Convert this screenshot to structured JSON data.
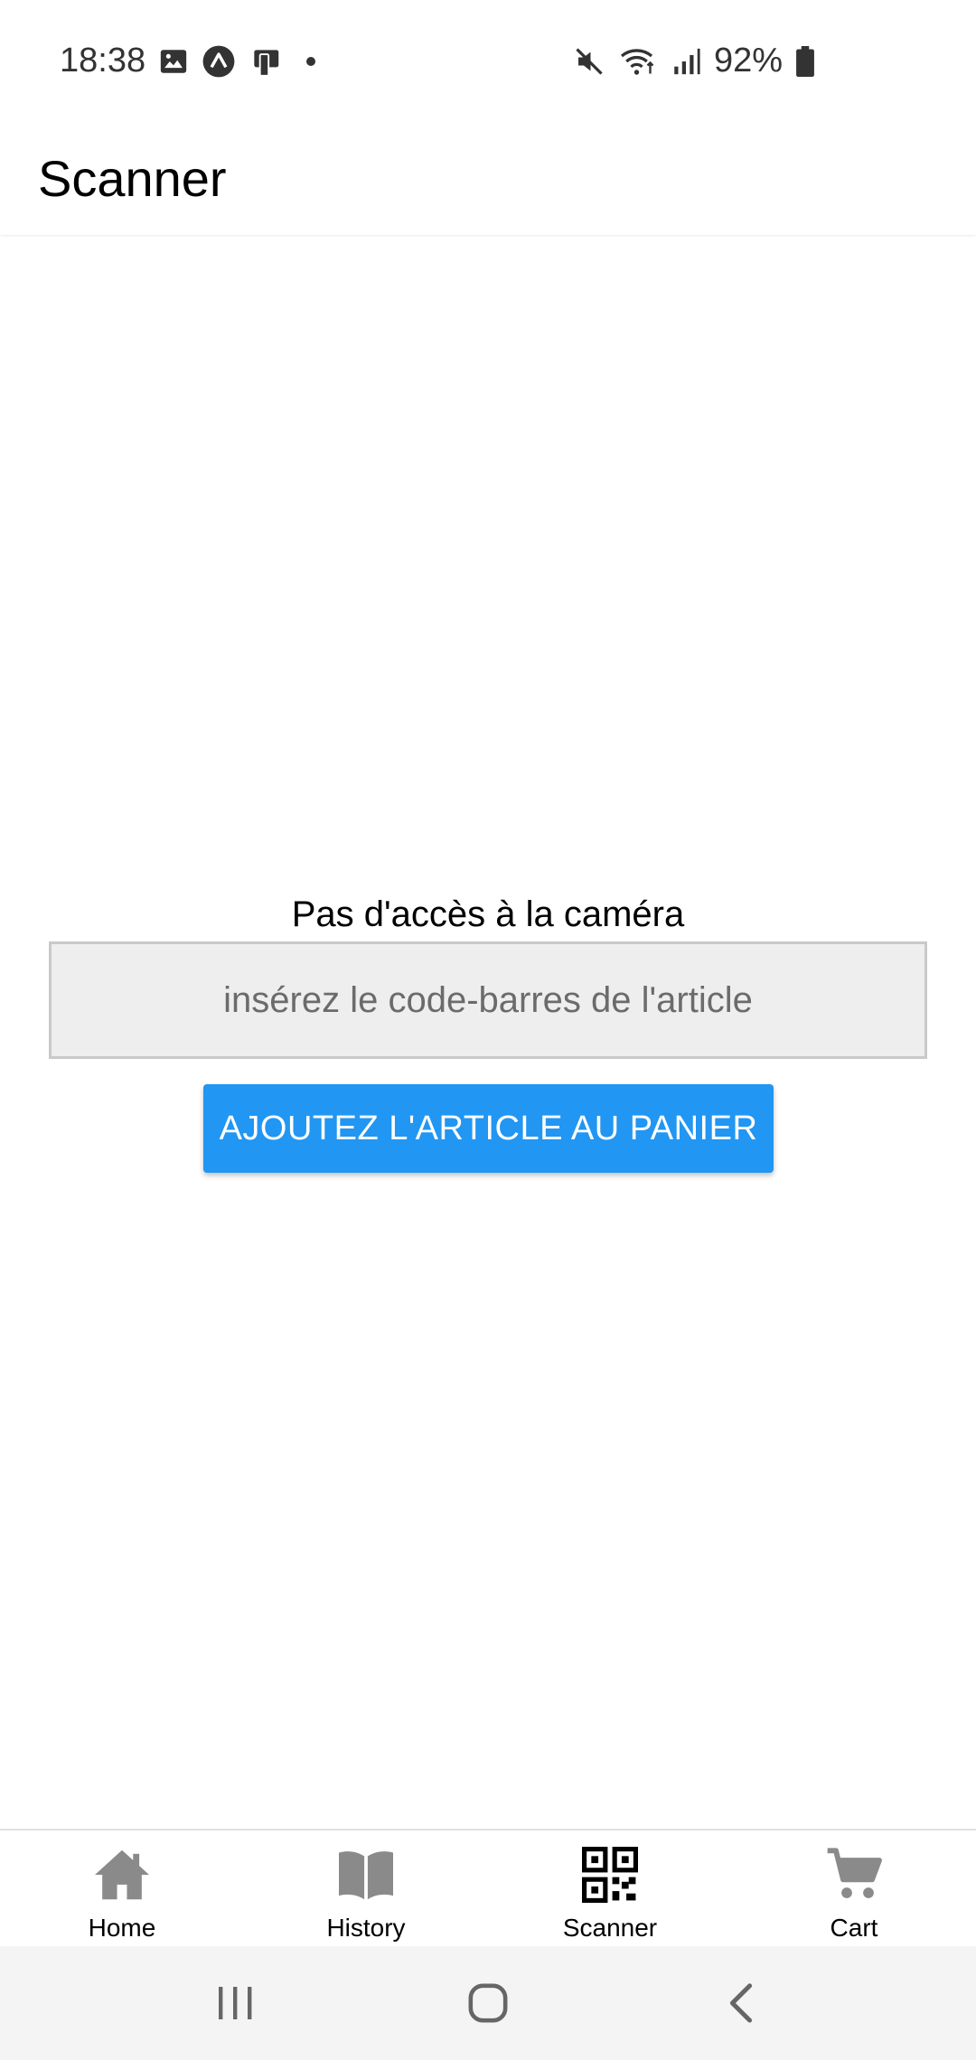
{
  "status_bar": {
    "time": "18:38",
    "battery": "92%",
    "left_icons": [
      "gallery-icon",
      "expo-icon",
      "cast-icon",
      "dot-icon"
    ],
    "right_icons": [
      "mute-icon",
      "wifi-icon",
      "signal-icon",
      "battery-icon"
    ]
  },
  "header": {
    "title": "Scanner"
  },
  "main": {
    "camera_message": "Pas d'accès à la caméra",
    "barcode_placeholder": "insérez le code-barres de l'article",
    "add_button_label": "AJOUTEZ L'ARTICLE AU PANIER"
  },
  "tabs": [
    {
      "label": "Home",
      "icon": "home-icon",
      "active": false
    },
    {
      "label": "History",
      "icon": "book-icon",
      "active": false
    },
    {
      "label": "Scanner",
      "icon": "qr-code-icon",
      "active": true
    },
    {
      "label": "Cart",
      "icon": "cart-icon",
      "active": false
    }
  ],
  "colors": {
    "accent": "#2196f3",
    "inactive_icon": "#8a8a8a",
    "active_icon": "#000000",
    "input_background": "#eeeeee"
  }
}
